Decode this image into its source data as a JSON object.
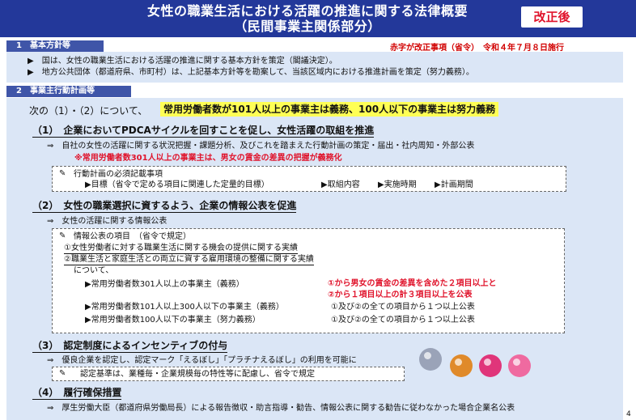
{
  "header": {
    "title_line1": "女性の職業生活における活躍の推進に関する法律概要",
    "title_line2": "（民間事業主関係部分）",
    "badge": "改正後"
  },
  "legend_note": "赤字が改正事項（省令）　令和４年７月８日施行",
  "section1": {
    "label": "1　基本方針等",
    "bullets": [
      "国は、女性の職業生活における活躍の推進に関する基本方針を策定（閣議決定）。",
      "地方公共団体（都道府県、市町村）は、上記基本方針等を勘案して、当該区域内における推進計画を策定（努力義務）。"
    ]
  },
  "section2": {
    "label": "2　事業主行動計画等",
    "intro": "次の（1）・（2）について、",
    "intro_highlight": "常用労働者数が101人以上の事業主は義務、100人以下の事業主は努力義務",
    "item1": {
      "heading": "（1）　企業においてPDCAサイクルを回すことを促し、女性活躍の取組を推進",
      "line_a": "⇒　自社の女性の活躍に関する状況把握・課題分析、及びこれを踏まえた行動計画の策定・届出・社内周知・外部公表",
      "line_red": "※常用労働者数301人以上の事業主は、男女の賃金の差異の把握が義務化",
      "box_title": "行動計画の必須記載事項",
      "box_item1": "▶目標（省令で定める項目に関連した定量的目標）",
      "box_item2": "▶取組内容",
      "box_item3": "▶実施時期",
      "box_item4": "▶計画期間"
    },
    "item2": {
      "heading": "（2）　女性の職業選択に資するよう、企業の情報公表を促進",
      "line_a": "⇒　女性の活躍に関する情報公表",
      "box_title": "情報公表の項目　（省令で規定）",
      "box_l1": "①女性労働者に対する職業生活に関する機会の提供に関する実績",
      "box_l2": "②職業生活と家庭生活との両立に資する雇用環境の整備に関する実績",
      "box_l3": "について、",
      "row1_label": "▶常用労働者数301人以上の事業主（義務）",
      "row1_red1": "①から男女の賃金の差異を含めた２項目以上と",
      "row1_red2": "②から１項目以上の計３項目以上を公表",
      "row2_label": "▶常用労働者数101人以上300人以下の事業主（義務）",
      "row2_value": "①及び②の全ての項目から１つ以上公表",
      "row3_label": "▶常用労働者数100人以下の事業主（努力義務）",
      "row3_value": "①及び②の全ての項目から１つ以上公表"
    },
    "item3": {
      "heading": "（3）　認定制度によるインセンティブの付与",
      "line_a": "⇒　優良企業を認定し、認定マーク「えるぼし」「プラチナえるぼし」の利用を可能に",
      "box_text": "認定基準は、業種毎・企業規模毎の特性等に配慮し、省令で規定"
    },
    "item4": {
      "heading": "（4）　履行確保措置",
      "line_a": "⇒　厚生労働大臣（都道府県労働局長）による報告徴収・助言指導・勧告、情報公表に関する勧告に従わなかった場合企業名公表"
    }
  },
  "page_number": "4",
  "colors": {
    "header_bg": "#23389a",
    "panel_bg": "#dbe6f6",
    "accent_red": "#e0132b",
    "highlight": "#ffff55"
  },
  "icons": [
    "clip-icon",
    "eruboshi-logo",
    "platinum-eruboshi-logo"
  ]
}
